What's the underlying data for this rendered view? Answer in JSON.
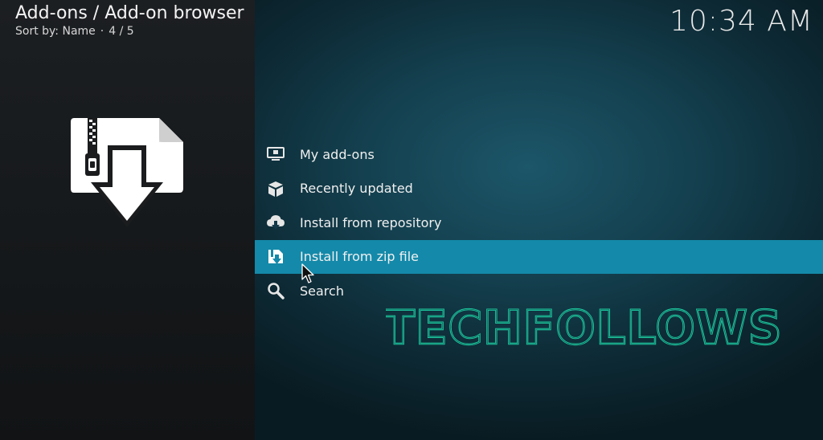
{
  "header": {
    "title": "Add-ons / Add-on browser",
    "sort_label": "Sort by: Name",
    "separator": "·",
    "position": "4 / 5"
  },
  "clock": "10:34 AM",
  "menu": {
    "items": [
      {
        "label": "My add-ons",
        "icon": "monitor-icon"
      },
      {
        "label": "Recently updated",
        "icon": "box-icon"
      },
      {
        "label": "Install from repository",
        "icon": "cloud-download-icon"
      },
      {
        "label": "Install from zip file",
        "icon": "zip-install-icon"
      },
      {
        "label": "Search",
        "icon": "search-icon"
      }
    ],
    "focused_index": 3
  },
  "watermark": "TECHFOLLOWS",
  "colors": {
    "focus": "#1489a9",
    "watermark": "#1fd1a6",
    "left_panel": "#1c1f22"
  }
}
